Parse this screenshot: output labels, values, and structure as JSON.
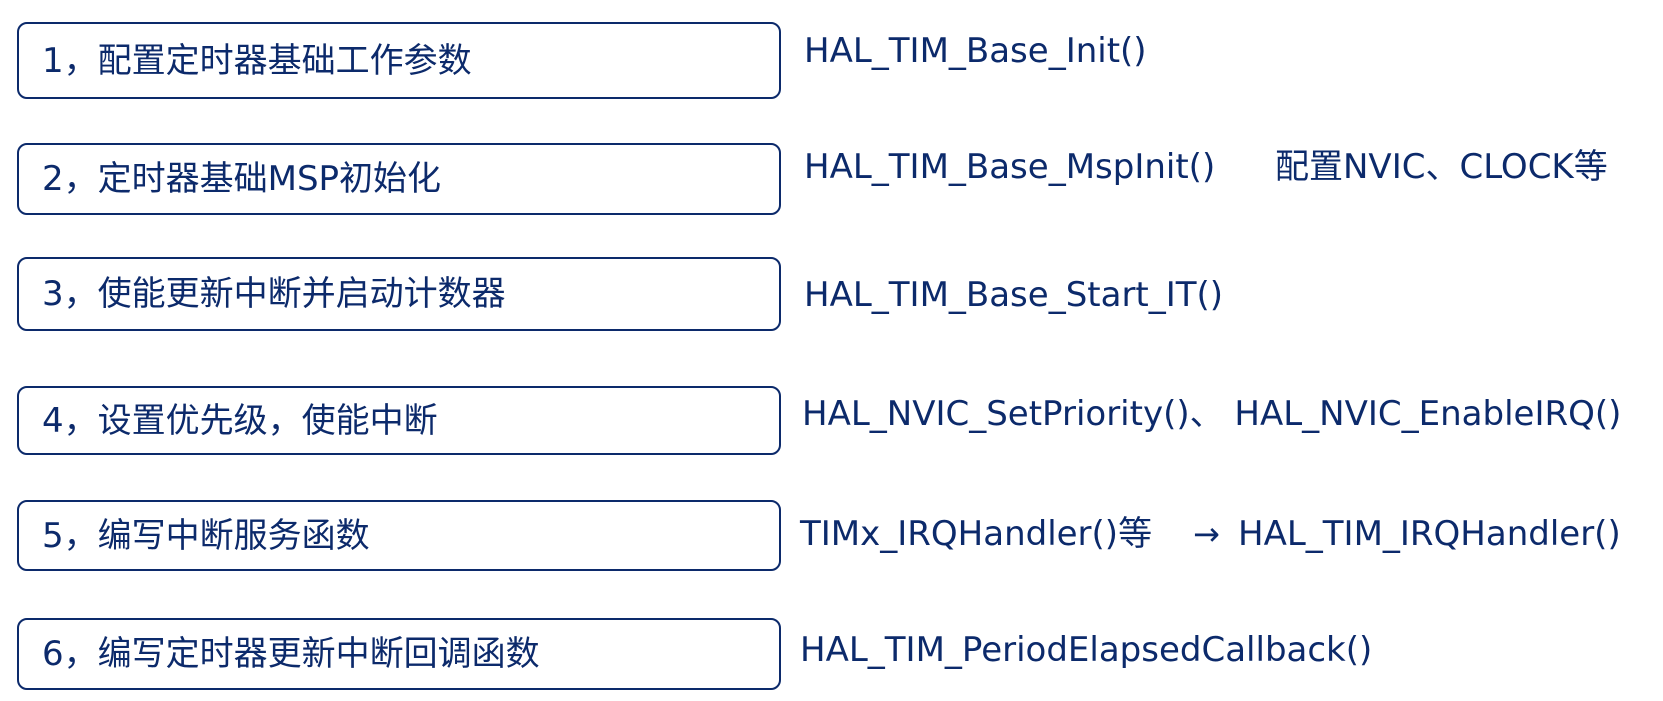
{
  "steps": [
    {
      "label": "1，配置定时器基础工作参数",
      "fn": "HAL_TIM_Base_Init()"
    },
    {
      "label": "2，定时器基础MSP初始化",
      "fn": "HAL_TIM_Base_MspInit()",
      "note": "配置NVIC、CLOCK等"
    },
    {
      "label": "3，使能更新中断并启动计数器",
      "fn": "HAL_TIM_Base_Start_IT()"
    },
    {
      "label": "4，设置优先级，使能中断",
      "fn": "HAL_NVIC_SetPriority()、 HAL_NVIC_EnableIRQ()"
    },
    {
      "label": "5，编写中断服务函数",
      "fn": "TIMx_IRQHandler()等",
      "arrow_symbol": "→",
      "target_fn": "HAL_TIM_IRQHandler()"
    },
    {
      "label": "6，编写定时器更新中断回调函数",
      "fn": "HAL_TIM_PeriodElapsedCallback()"
    }
  ],
  "colors": {
    "primary": "#0c2a6b",
    "secondary": "#000000",
    "background": "#ffffff"
  }
}
